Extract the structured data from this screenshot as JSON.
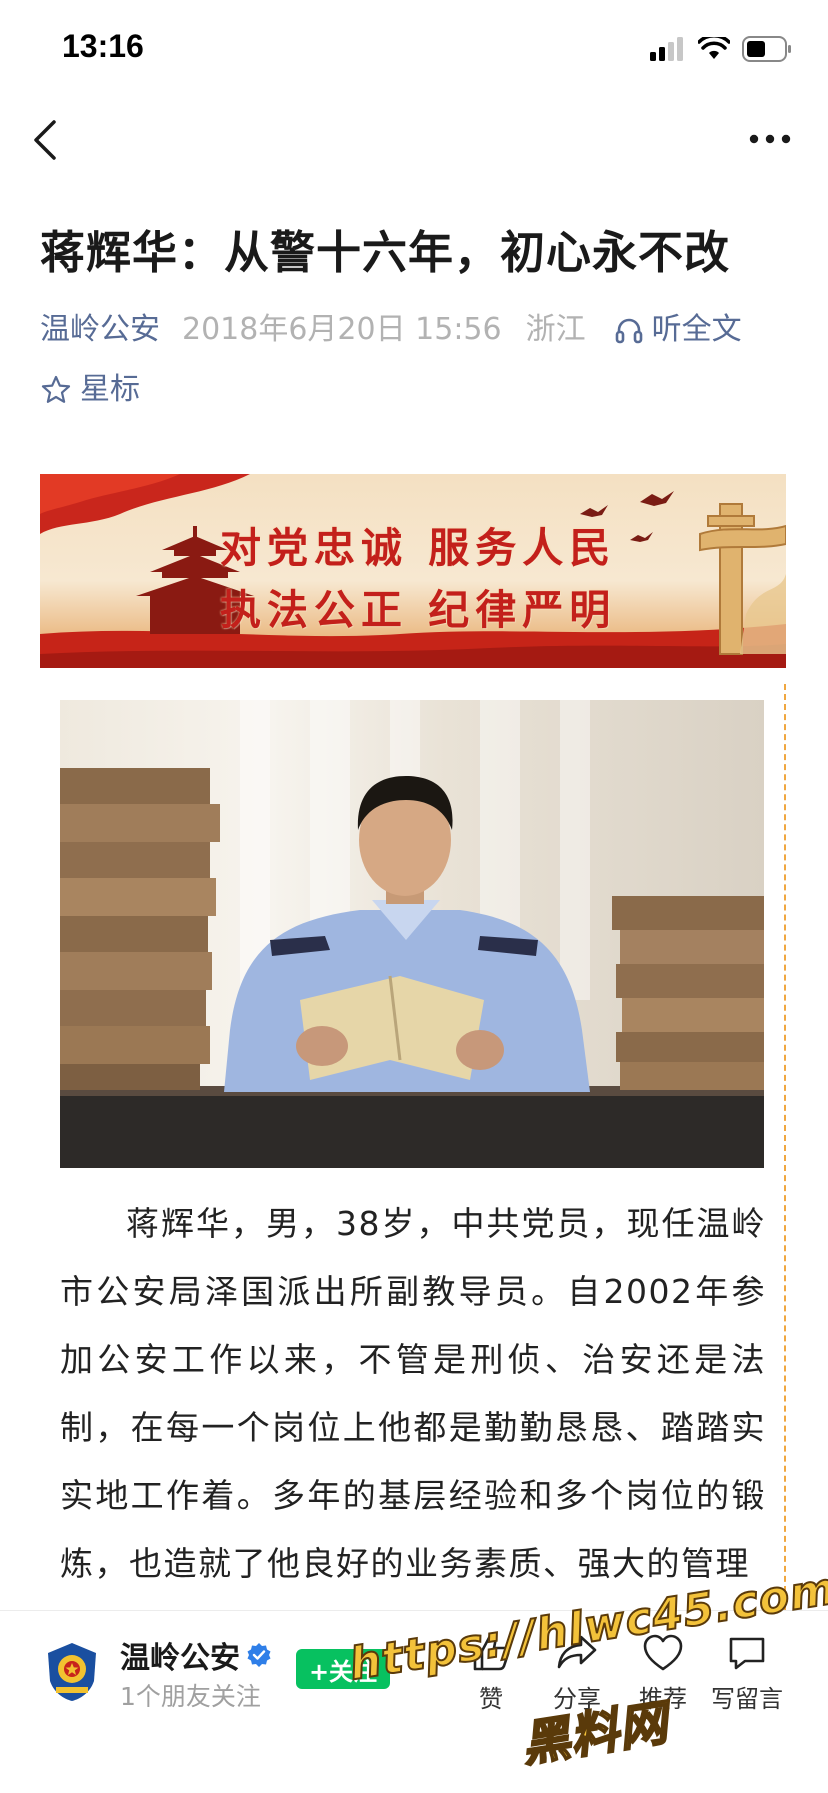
{
  "status_bar": {
    "time": "13:16"
  },
  "article": {
    "title": "蒋辉华：从警十六年，初心永不改",
    "author": "温岭公安",
    "date": "2018年6月20日 15:56",
    "region": "浙江",
    "listen_label": "听全文",
    "star_label": "星标",
    "body": "蒋辉华，男，38岁，中共党员，现任温岭市公安局泽国派出所副教导员。自2002年参加公安工作以来，不管是刑侦、治安还是法制，在每一个岗位上他都是勤勤恳恳、踏踏实实地工作着。多年的基层经验和多个岗位的锻炼，也造就了他良好的业务素质、强大的管理"
  },
  "banner": {
    "line1": "对党忠诚 服务人民",
    "line2": "执法公正 纪律严明"
  },
  "bottom_bar": {
    "account_name": "温岭公安",
    "friends_following": "1个朋友关注",
    "follow_label": "+关注",
    "actions": [
      {
        "label": "赞"
      },
      {
        "label": "分享"
      },
      {
        "label": "推荐"
      },
      {
        "label": "写留言"
      }
    ]
  },
  "watermark": {
    "url": "https://hlwc45.com",
    "site_name": "黑料网"
  },
  "colors": {
    "link_blue": "#576b95",
    "meta_gray": "#b2b2b2",
    "follow_green": "#07c160",
    "banner_red": "#c3201b",
    "watermark_yellow": "#f3c23a"
  }
}
